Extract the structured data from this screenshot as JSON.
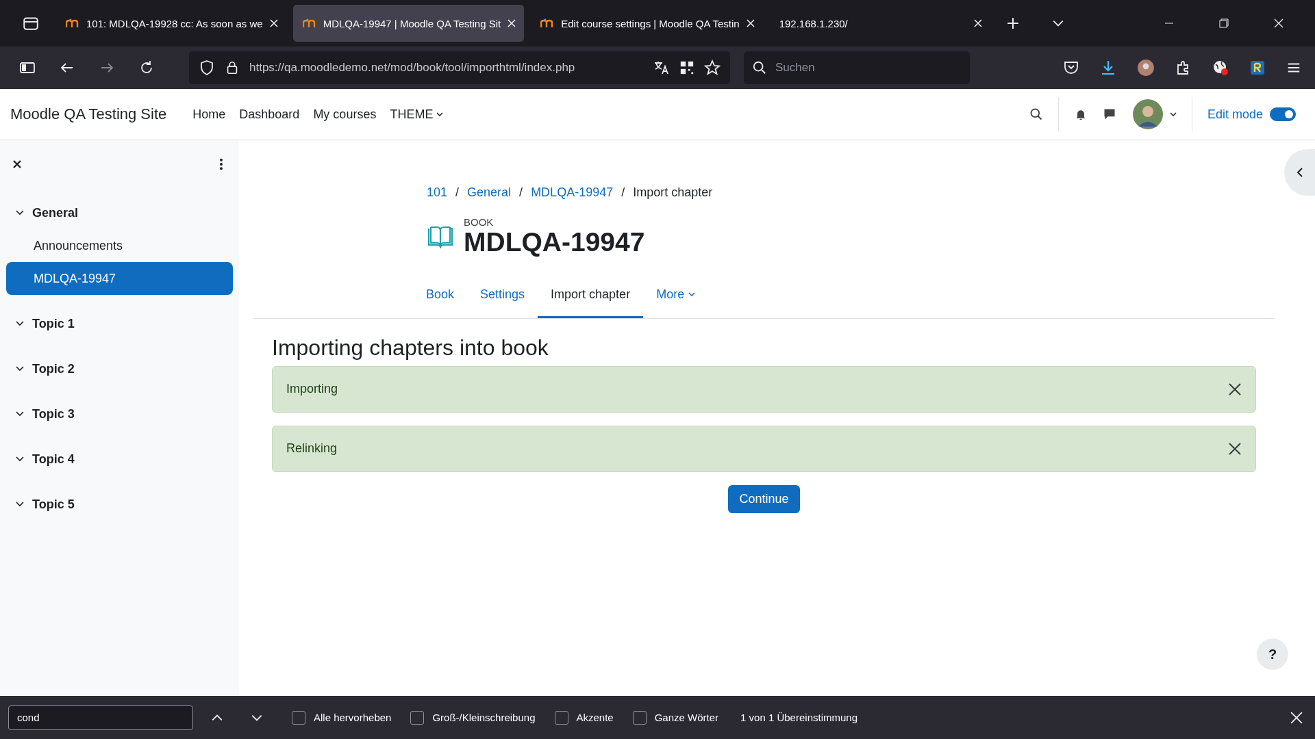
{
  "browser": {
    "tabs": [
      {
        "title": "101: MDLQA-19928 cc: As soon as we",
        "selected": false
      },
      {
        "title": "MDLQA-19947 | Moodle QA Testing Sit",
        "selected": true
      },
      {
        "title": "Edit course settings | Moodle QA Testin",
        "selected": false
      },
      {
        "title": "192.168.1.230/",
        "selected": false
      }
    ],
    "url": "https://qa.moodledemo.net/mod/book/tool/importhtml/index.php",
    "search_placeholder": "Suchen"
  },
  "navbar": {
    "site_name": "Moodle QA Testing Site",
    "links": [
      {
        "label": "Home",
        "dropdown": false
      },
      {
        "label": "Dashboard",
        "dropdown": false
      },
      {
        "label": "My courses",
        "dropdown": false
      },
      {
        "label": "THEME",
        "dropdown": true
      }
    ],
    "edit_mode_label": "Edit mode",
    "edit_mode_on": true
  },
  "sidebar": {
    "sections": [
      {
        "title": "General",
        "expanded": true,
        "children": [
          {
            "label": "Announcements",
            "selected": false
          },
          {
            "label": "MDLQA-19947",
            "selected": true
          }
        ]
      },
      {
        "title": "Topic 1",
        "expanded": true
      },
      {
        "title": "Topic 2",
        "expanded": true
      },
      {
        "title": "Topic 3",
        "expanded": true
      },
      {
        "title": "Topic 4",
        "expanded": true
      },
      {
        "title": "Topic 5",
        "expanded": true
      }
    ]
  },
  "breadcrumb": [
    {
      "label": "101",
      "link": true
    },
    {
      "separator": "/",
      "label": "General",
      "link": true
    },
    {
      "separator": "/",
      "label": "MDLQA-19947",
      "link": true
    },
    {
      "separator": "/",
      "label": "Import chapter",
      "link": false
    }
  ],
  "activity": {
    "type_label": "BOOK",
    "title": "MDLQA-19947"
  },
  "nav_tabs": [
    {
      "label": "Book",
      "selected": false,
      "dropdown": false
    },
    {
      "label": "Settings",
      "selected": false,
      "dropdown": false
    },
    {
      "label": "Import chapter",
      "selected": true,
      "dropdown": false
    },
    {
      "label": "More",
      "selected": false,
      "dropdown": true
    }
  ],
  "heading": "Importing chapters into book",
  "alerts": [
    {
      "text": "Importing"
    },
    {
      "text": "Relinking"
    }
  ],
  "continue_button": "Continue",
  "help_button": "?",
  "find_bar": {
    "query": "cond",
    "options": [
      {
        "label": "Alle hervorheben",
        "checked": false
      },
      {
        "label": "Groß-/Kleinschreibung",
        "checked": false
      },
      {
        "label": "Akzente",
        "checked": false
      },
      {
        "label": "Ganze Wörter",
        "checked": false
      }
    ],
    "result": "1 von 1 Übereinstimmung"
  }
}
